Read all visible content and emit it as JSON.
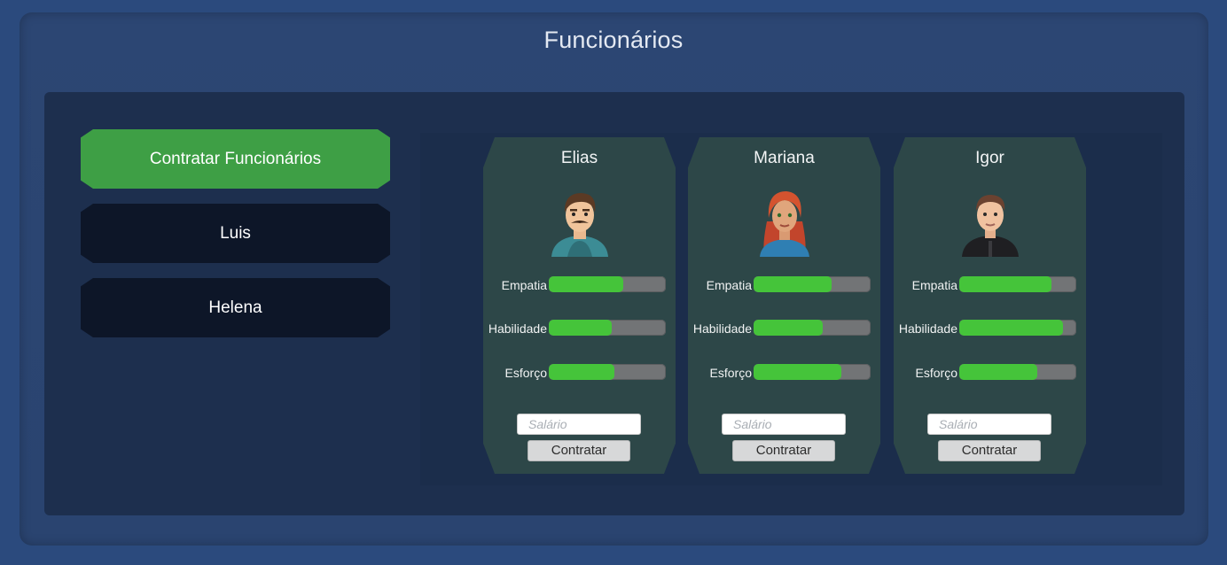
{
  "title": "Funcionários",
  "menu": {
    "items": [
      {
        "label": "Contratar Funcionários",
        "active": true
      },
      {
        "label": "Luis",
        "active": false
      },
      {
        "label": "Helena",
        "active": false
      }
    ]
  },
  "stat_labels": [
    "Empatia",
    "Habilidade",
    "Esforço"
  ],
  "salary_placeholder": "Salário",
  "hire_label": "Contratar",
  "colors": {
    "active_menu": "#3e9f45",
    "dark_menu": "#0d1628",
    "card": "#2d4748",
    "bar_fill": "#45c43a",
    "bar_track": "#727476"
  },
  "candidates": [
    {
      "name": "Elias",
      "avatar": "man-mustache-hoodie",
      "stats": [
        0.64,
        0.54,
        0.56
      ]
    },
    {
      "name": "Mariana",
      "avatar": "woman-red-hair",
      "stats": [
        0.67,
        0.59,
        0.75
      ]
    },
    {
      "name": "Igor",
      "avatar": "man-black-jacket",
      "stats": [
        0.79,
        0.89,
        0.67
      ]
    }
  ]
}
